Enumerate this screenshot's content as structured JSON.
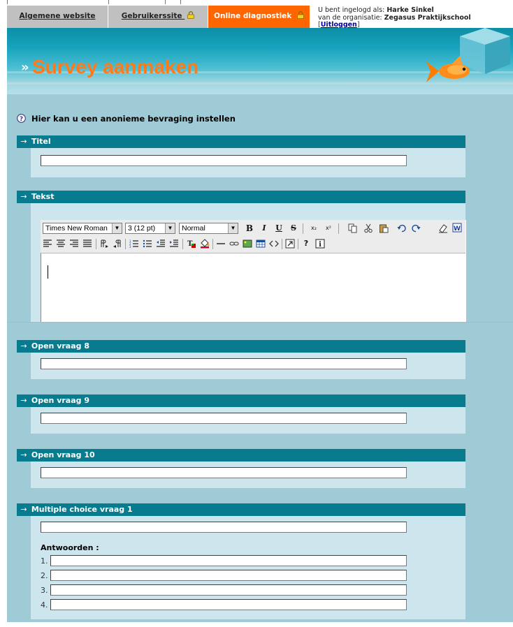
{
  "nav": {
    "tabs": [
      {
        "label": "Algemene website"
      },
      {
        "label": "Gebruikerssite"
      },
      {
        "label": "Online diagnostiek"
      }
    ],
    "user": {
      "line1_prefix": "U bent ingelogd als:",
      "user_name": "Harke Sinkel",
      "line2_prefix": "van de organisatie:",
      "organization": "Zegasus Praktijkschool",
      "logout_label": "Uitloggen"
    }
  },
  "banner": {
    "title": "Survey aanmaken"
  },
  "intro": {
    "text": "Hier kan u een anonieme bevraging instellen"
  },
  "sections": {
    "titel": {
      "label": "Titel",
      "value": ""
    },
    "tekst": {
      "label": "Tekst"
    },
    "open8": {
      "label": "Open vraag 8",
      "value": ""
    },
    "open9": {
      "label": "Open vraag 9",
      "value": ""
    },
    "open10": {
      "label": "Open vraag 10",
      "value": ""
    },
    "mc1": {
      "label": "Multiple choice vraag 1",
      "value": "",
      "answers_label": "Antwoorden  :",
      "answers": [
        {
          "num": "1.",
          "value": ""
        },
        {
          "num": "2.",
          "value": ""
        },
        {
          "num": "3.",
          "value": ""
        },
        {
          "num": "4.",
          "value": ""
        }
      ]
    }
  },
  "editor": {
    "font": "Times New Roman",
    "size": "3 (12 pt)",
    "format": "Normal",
    "bold": "B",
    "italic": "I",
    "underline": "U",
    "strike": "S",
    "subscript": "x₂",
    "superscript": "x²",
    "help": "?"
  },
  "colors": {
    "page_bg": "#9fcbd6",
    "section_header": "#097b8f",
    "section_body": "#cde6ed",
    "title_orange": "#ff7a1a",
    "tab_orange": "#ff6600",
    "tab_grey": "#c0c0c0"
  }
}
